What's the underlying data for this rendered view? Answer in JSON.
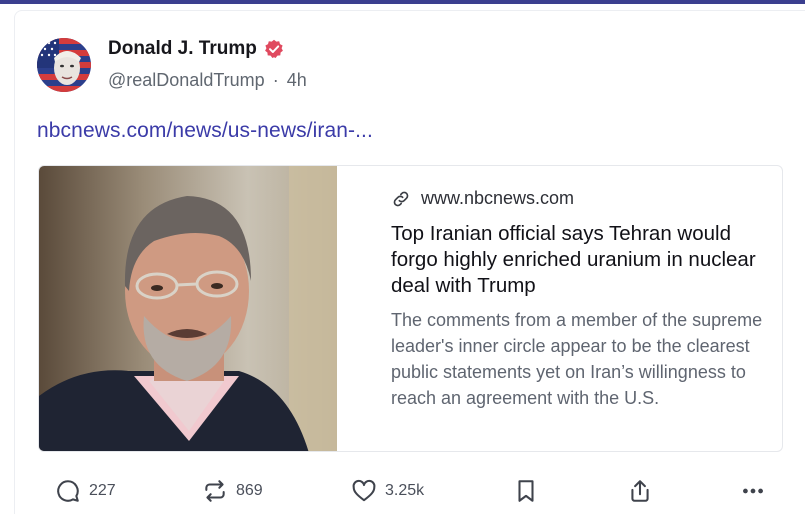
{
  "post": {
    "author_name": "Donald J. Trump",
    "handle": "@realDonaldTrump",
    "separator": "·",
    "time": "4h",
    "link_text": "nbcnews.com/news/us-news/iran-..."
  },
  "card": {
    "domain": "www.nbcnews.com",
    "title": "Top Iranian official says Tehran would forgo highly enriched uranium in nuclear deal with Trump",
    "description": "The comments from a member of the supreme leader's inner circle appear to be the clearest public statements yet on Iran’s willingness to reach an agreement with the U.S."
  },
  "actions": {
    "replies": "227",
    "reposts": "869",
    "likes": "3.25k"
  },
  "icons": [
    "verified-badge-icon",
    "link-icon",
    "reply-icon",
    "repost-icon",
    "like-icon",
    "bookmark-icon",
    "share-icon",
    "more-icon"
  ],
  "colors": {
    "accent": "#3b3f8f",
    "link": "#3b3ba8",
    "verified": "#e04a5f",
    "muted": "#606770"
  }
}
